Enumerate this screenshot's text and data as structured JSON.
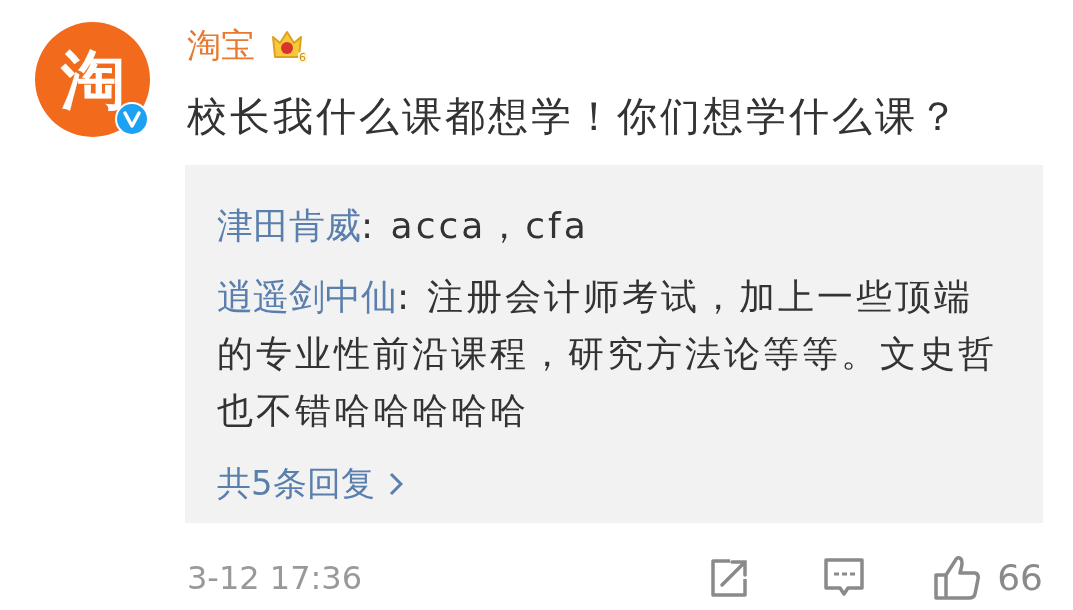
{
  "author": {
    "avatar_text": "淘",
    "name": "淘宝",
    "badge_level": "6",
    "verified": true
  },
  "content": "校长我什么课都想学！你们想学什么课？",
  "replies": [
    {
      "user": "津田肯威",
      "text": ": acca，cfa"
    },
    {
      "user": "逍遥剑中仙",
      "text": ": 注册会计师考试，加上一些顶端的专业性前沿课程，研究方法论等等。文史哲也不错哈哈哈哈哈"
    }
  ],
  "more_replies": "共5条回复",
  "time": "3-12 17:36",
  "likes": "66"
}
